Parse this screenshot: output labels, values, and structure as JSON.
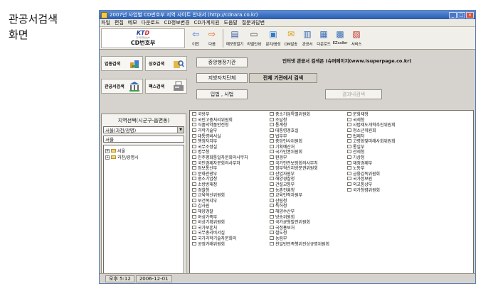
{
  "caption": {
    "line1": "관공서검색",
    "line2": "화면"
  },
  "window": {
    "title": "2007년 사업별 CD번호부 지역 사이트 안내서 (http://cdnara.co.kr)"
  },
  "menu": [
    "파일",
    "편집",
    "메모",
    "다운로드",
    "CD정보변경",
    "CD가계지원",
    "도움말",
    "질문과답변"
  ],
  "logo": {
    "mark_left": "KT",
    "mark_right": "D",
    "subtitle": "한국전화번호부",
    "name": "CD번호부"
  },
  "toolbar": [
    {
      "label": "이전",
      "icon": "back-arrow-icon",
      "glyph": "⇦",
      "color": "#2b6fd6"
    },
    {
      "label": "다음",
      "icon": "forward-arrow-icon",
      "glyph": "⇨",
      "color": "#e05a1f"
    },
    {
      "label": "메모장열기",
      "icon": "memo-icon",
      "glyph": "▤",
      "color": "#3a5fa6"
    },
    {
      "label": "라벨인쇄",
      "icon": "label-print-icon",
      "glyph": "▭",
      "color": "#555555"
    },
    {
      "label": "문자/음성",
      "icon": "sms-voice-icon",
      "glyph": "▣",
      "color": "#2d7ad0"
    },
    {
      "label": "DM발송",
      "icon": "dm-mail-icon",
      "glyph": "✉",
      "color": "#d9a21b"
    },
    {
      "label": "관공서",
      "icon": "government-building-icon",
      "glyph": "▥",
      "color": "#3b6eb7"
    },
    {
      "label": "다운로드",
      "icon": "download-icon",
      "glyph": "▦",
      "color": "#3b6eb7"
    },
    {
      "label": "EZcaller",
      "icon": "ezcaller-icon",
      "glyph": "▩",
      "color": "#3b6eb7"
    },
    {
      "label": "서비스",
      "icon": "service-icon",
      "glyph": "▨",
      "color": "#c0302b"
    }
  ],
  "categories": [
    {
      "label": "업종검색",
      "icon": "industry-search-icon"
    },
    {
      "label": "상호검색",
      "icon": "business-name-search-icon"
    },
    {
      "label": "관공서검색",
      "icon": "government-search-icon"
    },
    {
      "label": "팩스검색",
      "icon": "fax-search-icon"
    }
  ],
  "buttons": {
    "central": "중앙행정기관",
    "local": "지방자치단체",
    "legislative": "입법 , 사법",
    "search_all": "전체 기관에서 검색",
    "show_results": "결과내검색"
  },
  "notice": "인터넷 관공서 검색은 (슈퍼페이지(www.isuperpage.co.kr)",
  "region": {
    "label": "지역선택(시군구-읍면동)",
    "selected": "서울(과천/광명)",
    "input_value": "서울",
    "tree": [
      {
        "label": "서울",
        "expanded": false
      },
      {
        "label": "과천/광명시",
        "expanded": false
      }
    ]
  },
  "agencies": {
    "col1": [
      "국방부",
      "국민고충처리위원회",
      "식품의약품안전청",
      "과학기술부",
      "대통령비서실",
      "행정자치부",
      "국무조정실",
      "병무청",
      "민주평화통일자문회의사무처",
      "국민경제자문회의사무처",
      "정보통신부",
      "문화관광부",
      "중소기업청",
      "소방방재청",
      "경찰청",
      "교육혁신위원회",
      "보건복지부",
      "감사원",
      "해양경찰",
      "여성가족부",
      "비상기획위원회",
      "국가보훈처",
      "국무총리비서실",
      "국가과학기술자문회의",
      "공정거래위원회"
    ],
    "col2": [
      "중소기업특별위원회",
      "조달청",
      "통계청",
      "대통령경호실",
      "법무부",
      "중앙인사위원회",
      "기획예산처",
      "국가인권위원회",
      "환경부",
      "국가안전보장회의사무처",
      "정부혁신지방분권위원회",
      "산업자원부",
      "해양경찰청",
      "건설교통부",
      "농촌진흥청",
      "교육인적자원부",
      "산림청",
      "특허청",
      "해양수산부",
      "방송위원회",
      "국가균형발전위원회",
      "국정홍보처",
      "철도청",
      "농림부",
      "친일반민족행위진상규명위원회"
    ],
    "col3": [
      "문화재청",
      "국세청",
      "사법제도개혁추진위원회",
      "청소년위원회",
      "법제처",
      "고령화및미래사회위원회",
      "통일부",
      "관세청",
      "기상청",
      "재정경제부",
      "노동부",
      "금융감독위원회",
      "국가정보원",
      "외교통상부",
      "국가청렴위원회"
    ]
  },
  "status": {
    "time": "오후 5:12",
    "date": "2006-12-01"
  }
}
